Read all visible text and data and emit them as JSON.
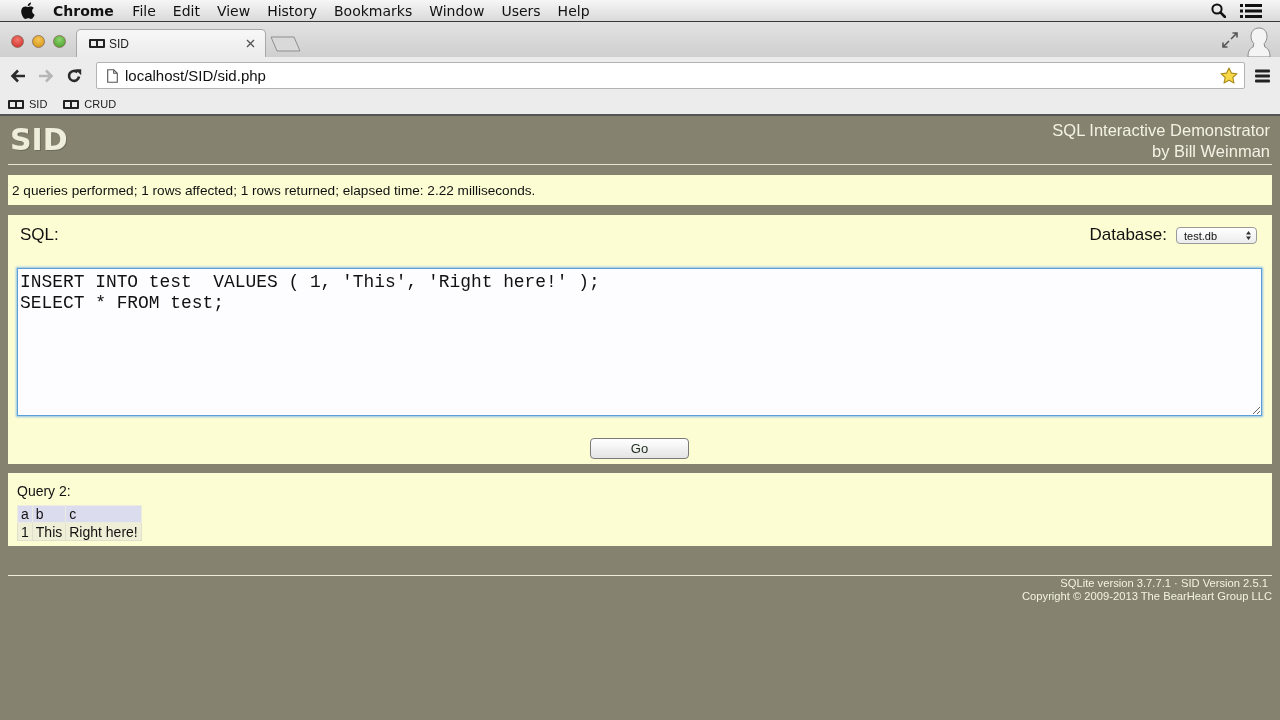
{
  "menu_bar": {
    "app": "Chrome",
    "items": [
      "File",
      "Edit",
      "View",
      "History",
      "Bookmarks",
      "Window",
      "Users",
      "Help"
    ]
  },
  "tabs": [
    {
      "label": "SID",
      "selected": true
    }
  ],
  "toolbar": {
    "buttons": [
      {
        "kind": "back",
        "disabled": false
      },
      {
        "kind": "forward",
        "disabled": true
      },
      {
        "kind": "reload",
        "disabled": false
      }
    ],
    "url": "localhost/SID/sid.php",
    "bookmarked": true
  },
  "bookmarks": [
    {
      "label": "SID"
    },
    {
      "label": "CRUD"
    }
  ],
  "header": {
    "logo": "SID",
    "title_lines": [
      "SQL Interactive Demonstrator",
      "by Bill Weinman"
    ]
  },
  "status_message": "2 queries performed; 1 rows affected; 1 rows returned; elapsed time: 2.22 milliseconds.",
  "sql_form": {
    "label": "SQL:",
    "database_label": "Database:",
    "database": "test.db",
    "query": "INSERT INTO test  VALUES ( 1, 'This', 'Right here!' );\nSELECT * FROM test;",
    "focused": true,
    "submit": "Go"
  },
  "results": [
    {
      "title": "Query 2:",
      "columns": [
        "a",
        "b",
        "c"
      ],
      "rows": [
        [
          "1",
          "This",
          "Right here!"
        ]
      ]
    }
  ],
  "footer": [
    "SQLite version 3.7.7.1 · SID Version 2.5.1",
    "Copyright © 2009-2013 The BearHeart Group LLC"
  ]
}
